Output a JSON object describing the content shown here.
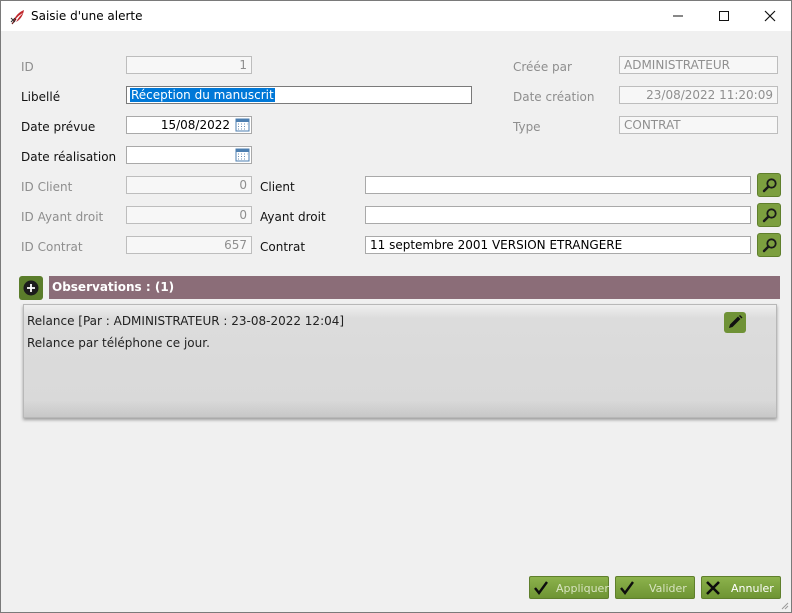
{
  "window": {
    "title": "Saisie d'une alerte",
    "title_icon": "feather-quill-icon"
  },
  "form": {
    "id": {
      "label": "ID",
      "value": "1"
    },
    "libelle": {
      "label": "Libellé",
      "value": "Réception du manuscrit"
    },
    "date_prevue": {
      "label": "Date prévue",
      "value": "15/08/2022"
    },
    "date_realisation": {
      "label": "Date réalisation",
      "value": ""
    },
    "id_client": {
      "label": "ID Client",
      "value": "0"
    },
    "id_ayant_droit": {
      "label": "ID Ayant droit",
      "value": "0"
    },
    "id_contrat": {
      "label": "ID Contrat",
      "value": "657"
    },
    "client": {
      "label": "Client",
      "value": ""
    },
    "ayant_droit": {
      "label": "Ayant droit",
      "value": ""
    },
    "contrat": {
      "label": "Contrat",
      "value": "11 septembre 2001 VERSION ETRANGERE"
    },
    "creee_par": {
      "label": "Créée par",
      "value": "ADMINISTRATEUR"
    },
    "date_creation": {
      "label": "Date création",
      "value": "23/08/2022 11:20:09"
    },
    "type": {
      "label": "Type",
      "value": "CONTRAT"
    }
  },
  "observations": {
    "title": "Observations : (1)",
    "items": [
      {
        "header": "Relance [Par :  ADMINISTRATEUR : 23-08-2022 12:04]",
        "text": "Relance par téléphone ce jour."
      }
    ]
  },
  "actions": {
    "apply": "Appliquer",
    "validate": "Valider",
    "cancel": "Annuler"
  },
  "colors": {
    "accent_green": "#7c9f3f",
    "observations_bar": "#8b6d78",
    "selection_blue": "#0078d7"
  }
}
